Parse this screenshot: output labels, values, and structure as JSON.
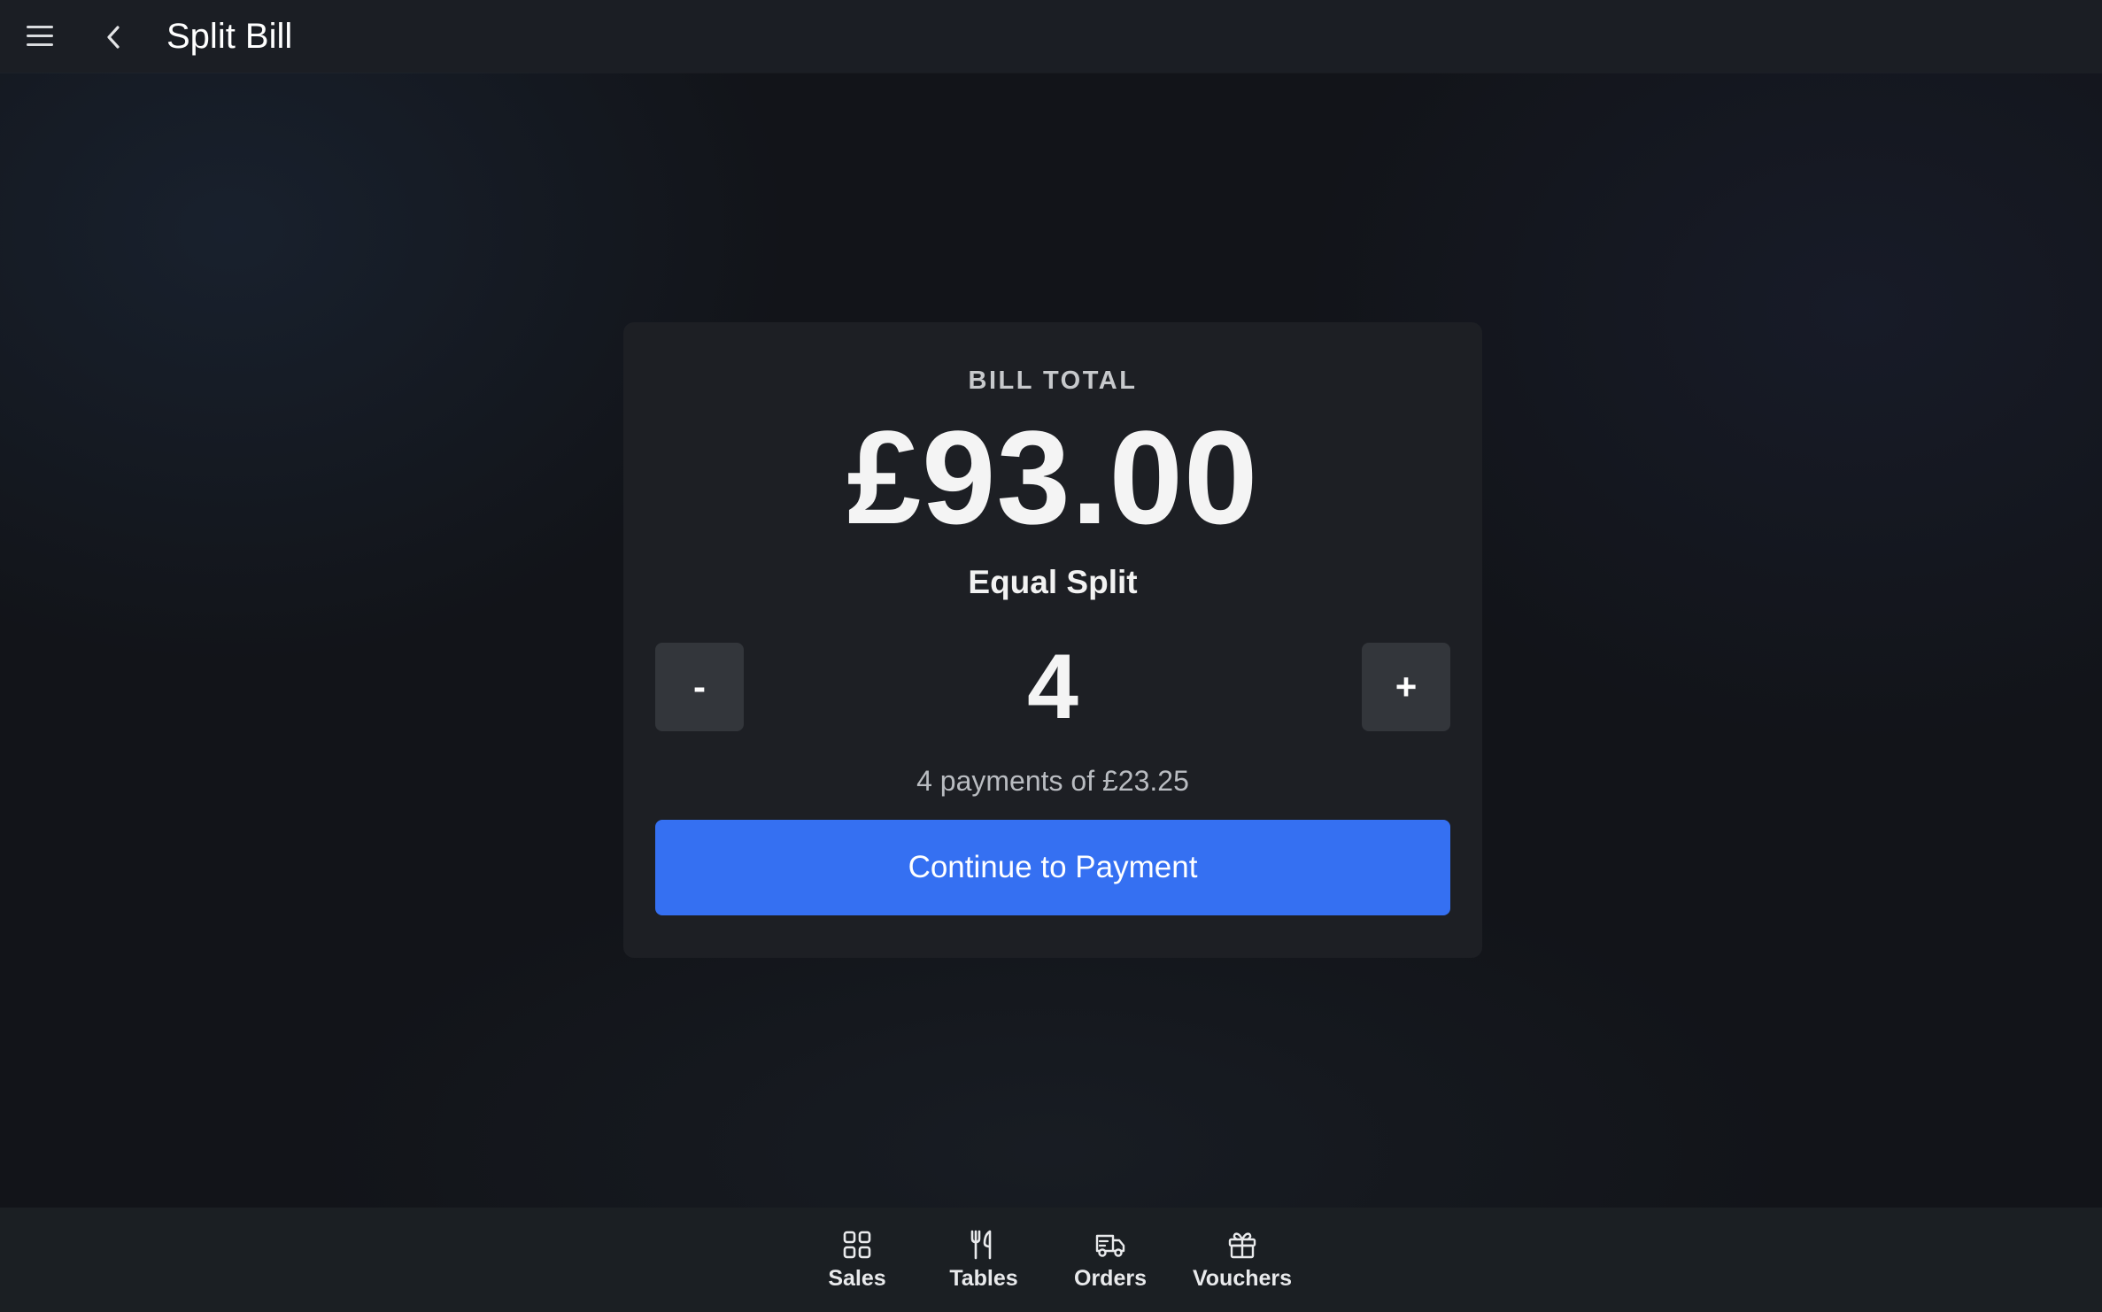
{
  "header": {
    "title": "Split Bill",
    "menu_icon": "hamburger-menu-icon",
    "back_icon": "chevron-left-icon"
  },
  "bill": {
    "label": "BILL TOTAL",
    "total": "£93.00",
    "split_mode": "Equal Split",
    "decrement_label": "-",
    "increment_label": "+",
    "split_count": "4",
    "payments_summary": "4 payments of £23.25",
    "continue_label": "Continue to Payment"
  },
  "bottom_nav": {
    "items": [
      {
        "label": "Sales",
        "icon": "grid-icon"
      },
      {
        "label": "Tables",
        "icon": "utensils-icon"
      },
      {
        "label": "Orders",
        "icon": "delivery-truck-icon"
      },
      {
        "label": "Vouchers",
        "icon": "gift-icon"
      }
    ]
  },
  "colors": {
    "background": "#121419",
    "header": "#1b1e24",
    "card": "#1d1f24",
    "stepper_button": "#33363b",
    "primary_button": "#3570f2",
    "muted_text": "#b9bcc1"
  }
}
